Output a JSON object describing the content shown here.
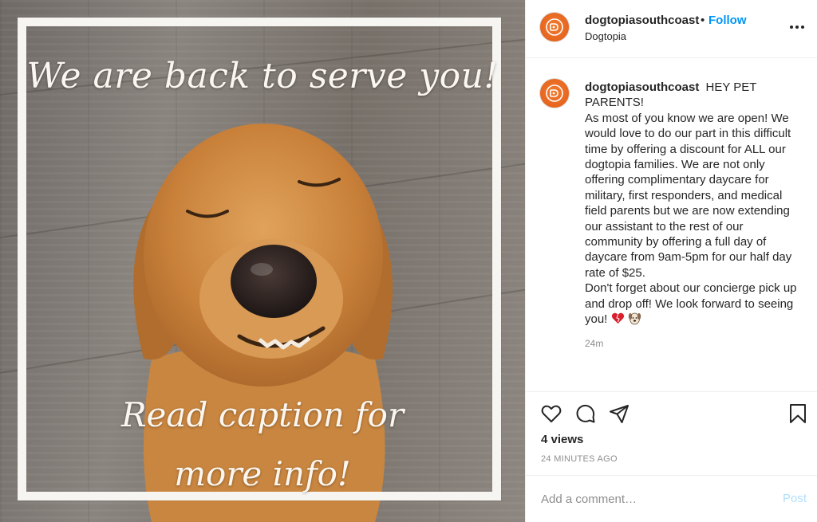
{
  "post": {
    "overlay_top": "We are back to serve you!",
    "overlay_bottom_line1": "Read caption for",
    "overlay_bottom_line2": "more info!"
  },
  "header": {
    "username": "dogtopiasouthcoast",
    "separator": "•",
    "follow_label": "Follow",
    "location": "Dogtopia",
    "more_icon": "more-horizontal-icon"
  },
  "caption": {
    "username": "dogtopiasouthcoast",
    "paragraph1": "HEY PET PARENTS!",
    "paragraph2": "As most of you know we are open! We would love to do our part in this difficult time by offering a discount for ALL our dogtopia families. We are not only offering complimentary daycare for military, first responders, and medical field parents but we are now extending our assistant to the rest of our community by offering a full day of daycare from 9am-5pm for our half day rate of $25.",
    "paragraph3": "Don't forget about our concierge pick up and drop off! We look forward to seeing you!",
    "emojis": [
      "heart-emoji",
      "dog-face-emoji"
    ],
    "time_ago": "24m"
  },
  "actions": {
    "icons": [
      "heart-icon",
      "comment-icon",
      "share-icon",
      "bookmark-icon"
    ],
    "views": "4 views",
    "posted": "24 MINUTES AGO"
  },
  "comment": {
    "placeholder": "Add a comment…",
    "post_label": "Post"
  },
  "colors": {
    "link_blue": "#0095f6",
    "post_disabled": "#b2dffc",
    "muted": "#8e8e8e",
    "avatar_orange": "#e35c18"
  }
}
